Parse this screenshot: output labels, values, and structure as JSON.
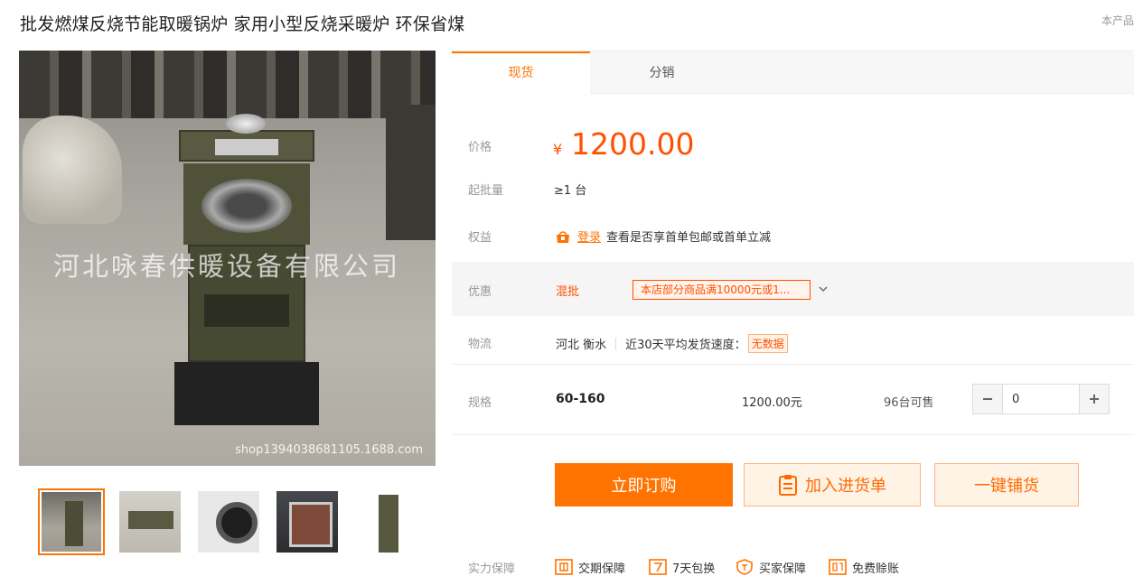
{
  "header": {
    "title": "批发燃煤反烧节能取暖锅炉 家用小型反烧采暖炉 环保省煤",
    "corner_note": "本产品"
  },
  "gallery": {
    "main_photo": {
      "watermark": "河北咏春供暖设备有限公司",
      "url_text": "shop1394038681105.1688.com"
    },
    "thumbnails": [
      {
        "alt": "stove-front",
        "active": true
      },
      {
        "alt": "stove-side",
        "active": false
      },
      {
        "alt": "stove-top-ring",
        "active": false
      },
      {
        "alt": "stove-door",
        "active": false
      },
      {
        "alt": "stove-white-bg",
        "active": false
      }
    ]
  },
  "tabs": [
    {
      "label": "现货",
      "active": true
    },
    {
      "label": "分销",
      "active": false
    }
  ],
  "price": {
    "label": "价格",
    "currency": "¥",
    "value": "1200.00"
  },
  "moq": {
    "label": "起批量",
    "value": "≥1 台"
  },
  "rights": {
    "label": "权益",
    "login_link": "登录",
    "text": "查看是否享首单包邮或首单立减"
  },
  "promotion": {
    "label": "优惠",
    "type": "混批",
    "tag": "本店部分商品满10000元或1..."
  },
  "logistics": {
    "label": "物流",
    "origin": "河北 衡水",
    "speed_label": "近30天平均发货速度：",
    "speed_value": "无数据"
  },
  "spec": {
    "label": "规格",
    "name": "60-160",
    "price": "1200.00元",
    "stock": "96台可售",
    "quantity": "0"
  },
  "actions": {
    "order": "立即订购",
    "add_cart": "加入进货单",
    "distribute": "一键铺货"
  },
  "guarantee": {
    "label": "实力保障",
    "items": [
      {
        "icon": "trade-shield-icon",
        "label": "交期保障"
      },
      {
        "icon": "seven-days-icon",
        "label": "7天包换"
      },
      {
        "icon": "buyer-protection-icon",
        "label": "买家保障"
      },
      {
        "icon": "compensation-icon",
        "label": "免费赊账"
      }
    ]
  },
  "colors": {
    "accent": "#ff7300",
    "price": "#ff5000",
    "muted": "#999999"
  }
}
